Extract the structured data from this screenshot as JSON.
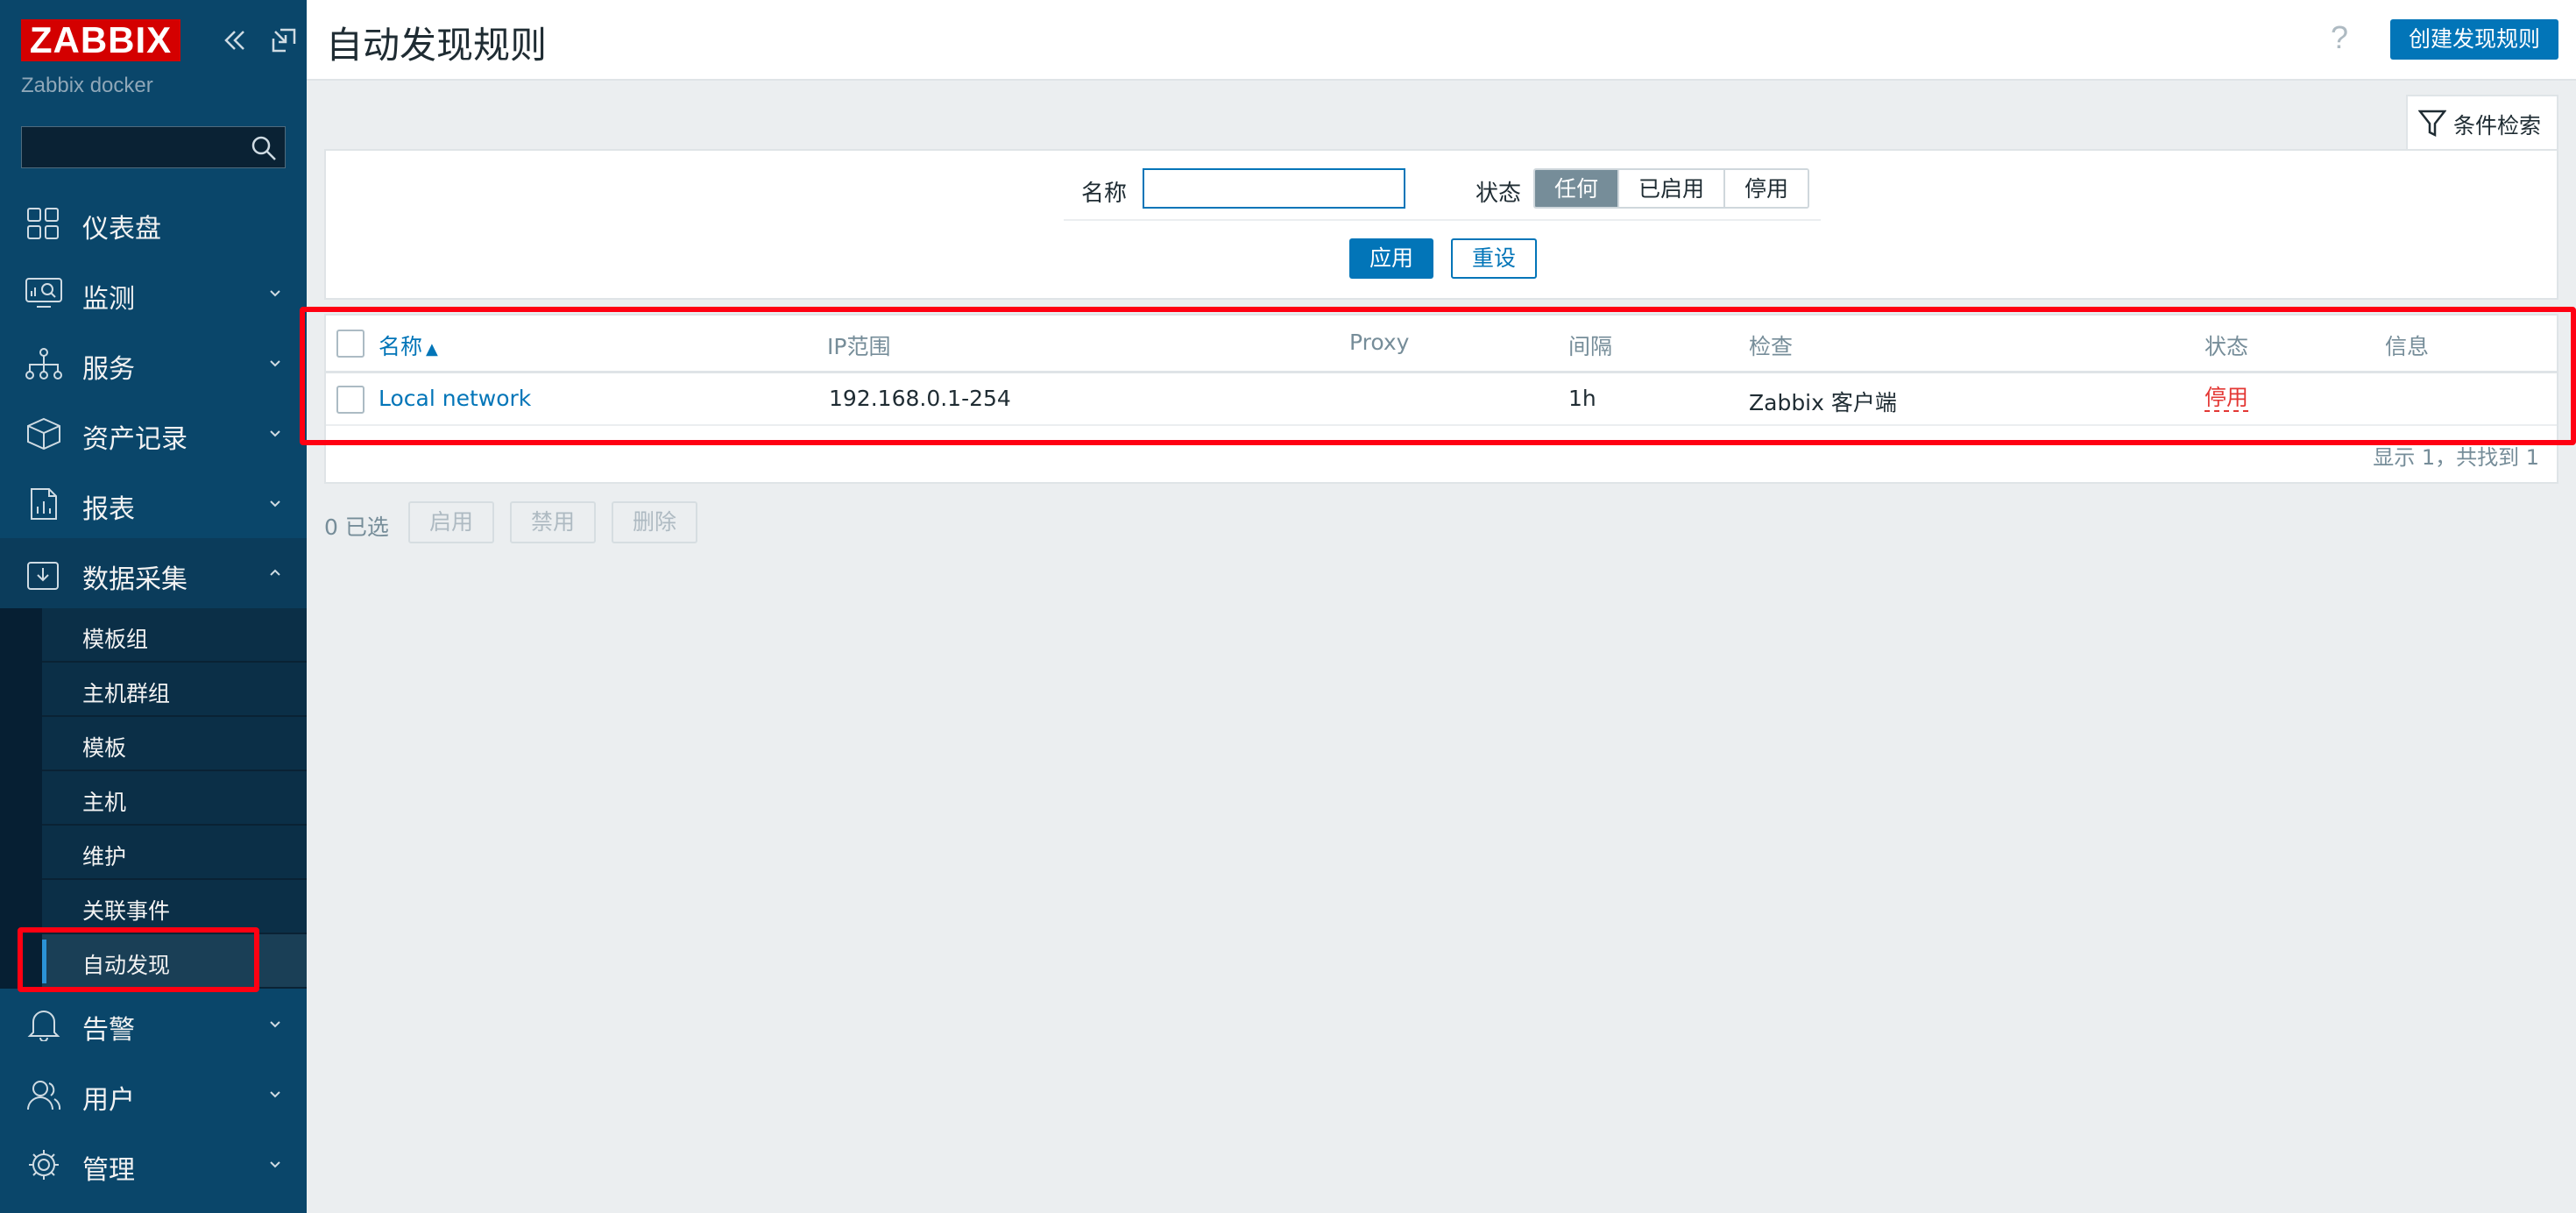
{
  "sidebar": {
    "logo": "ZABBIX",
    "server_name": "Zabbix docker",
    "search_placeholder": "",
    "menu": [
      {
        "label": "仪表盘",
        "icon": "dashboard-icon"
      },
      {
        "label": "监测",
        "icon": "monitoring-icon"
      },
      {
        "label": "服务",
        "icon": "services-icon"
      },
      {
        "label": "资产记录",
        "icon": "inventory-icon"
      },
      {
        "label": "报表",
        "icon": "reports-icon"
      },
      {
        "label": "数据采集",
        "icon": "data-collection-icon"
      }
    ],
    "submenu": [
      {
        "label": "模板组"
      },
      {
        "label": "主机群组"
      },
      {
        "label": "模板"
      },
      {
        "label": "主机"
      },
      {
        "label": "维护"
      },
      {
        "label": "关联事件"
      },
      {
        "label": "自动发现"
      }
    ],
    "menu_bottom": [
      {
        "label": "告警",
        "icon": "alerts-icon"
      },
      {
        "label": "用户",
        "icon": "users-icon"
      },
      {
        "label": "管理",
        "icon": "administration-icon"
      }
    ]
  },
  "header": {
    "title": "自动发现规则",
    "help": "?",
    "create_button": "创建发现规则"
  },
  "filter": {
    "tab_label": "条件检索",
    "name_label": "名称",
    "name_value": "",
    "status_label": "状态",
    "status_options": [
      "任何",
      "已启用",
      "停用"
    ],
    "status_selected": "任何",
    "apply": "应用",
    "reset": "重设"
  },
  "table": {
    "columns": {
      "name": "名称",
      "sort_indicator": "▲",
      "ip_range": "IP范围",
      "proxy": "Proxy",
      "interval": "间隔",
      "checks": "检查",
      "status": "状态",
      "info": "信息"
    },
    "rows": [
      {
        "name": "Local network",
        "ip_range": "192.168.0.1-254",
        "proxy": "",
        "interval": "1h",
        "checks": "Zabbix 客户端",
        "status": "停用",
        "info": ""
      }
    ],
    "footer": "显示 1，共找到 1"
  },
  "actions": {
    "selected": "0 已选",
    "enable": "启用",
    "disable": "禁用",
    "delete": "删除"
  },
  "colors": {
    "sidebar_bg": "#0a466a",
    "accent": "#0275b8",
    "highlight_red": "#ff0012",
    "status_disabled": "#e33734"
  }
}
